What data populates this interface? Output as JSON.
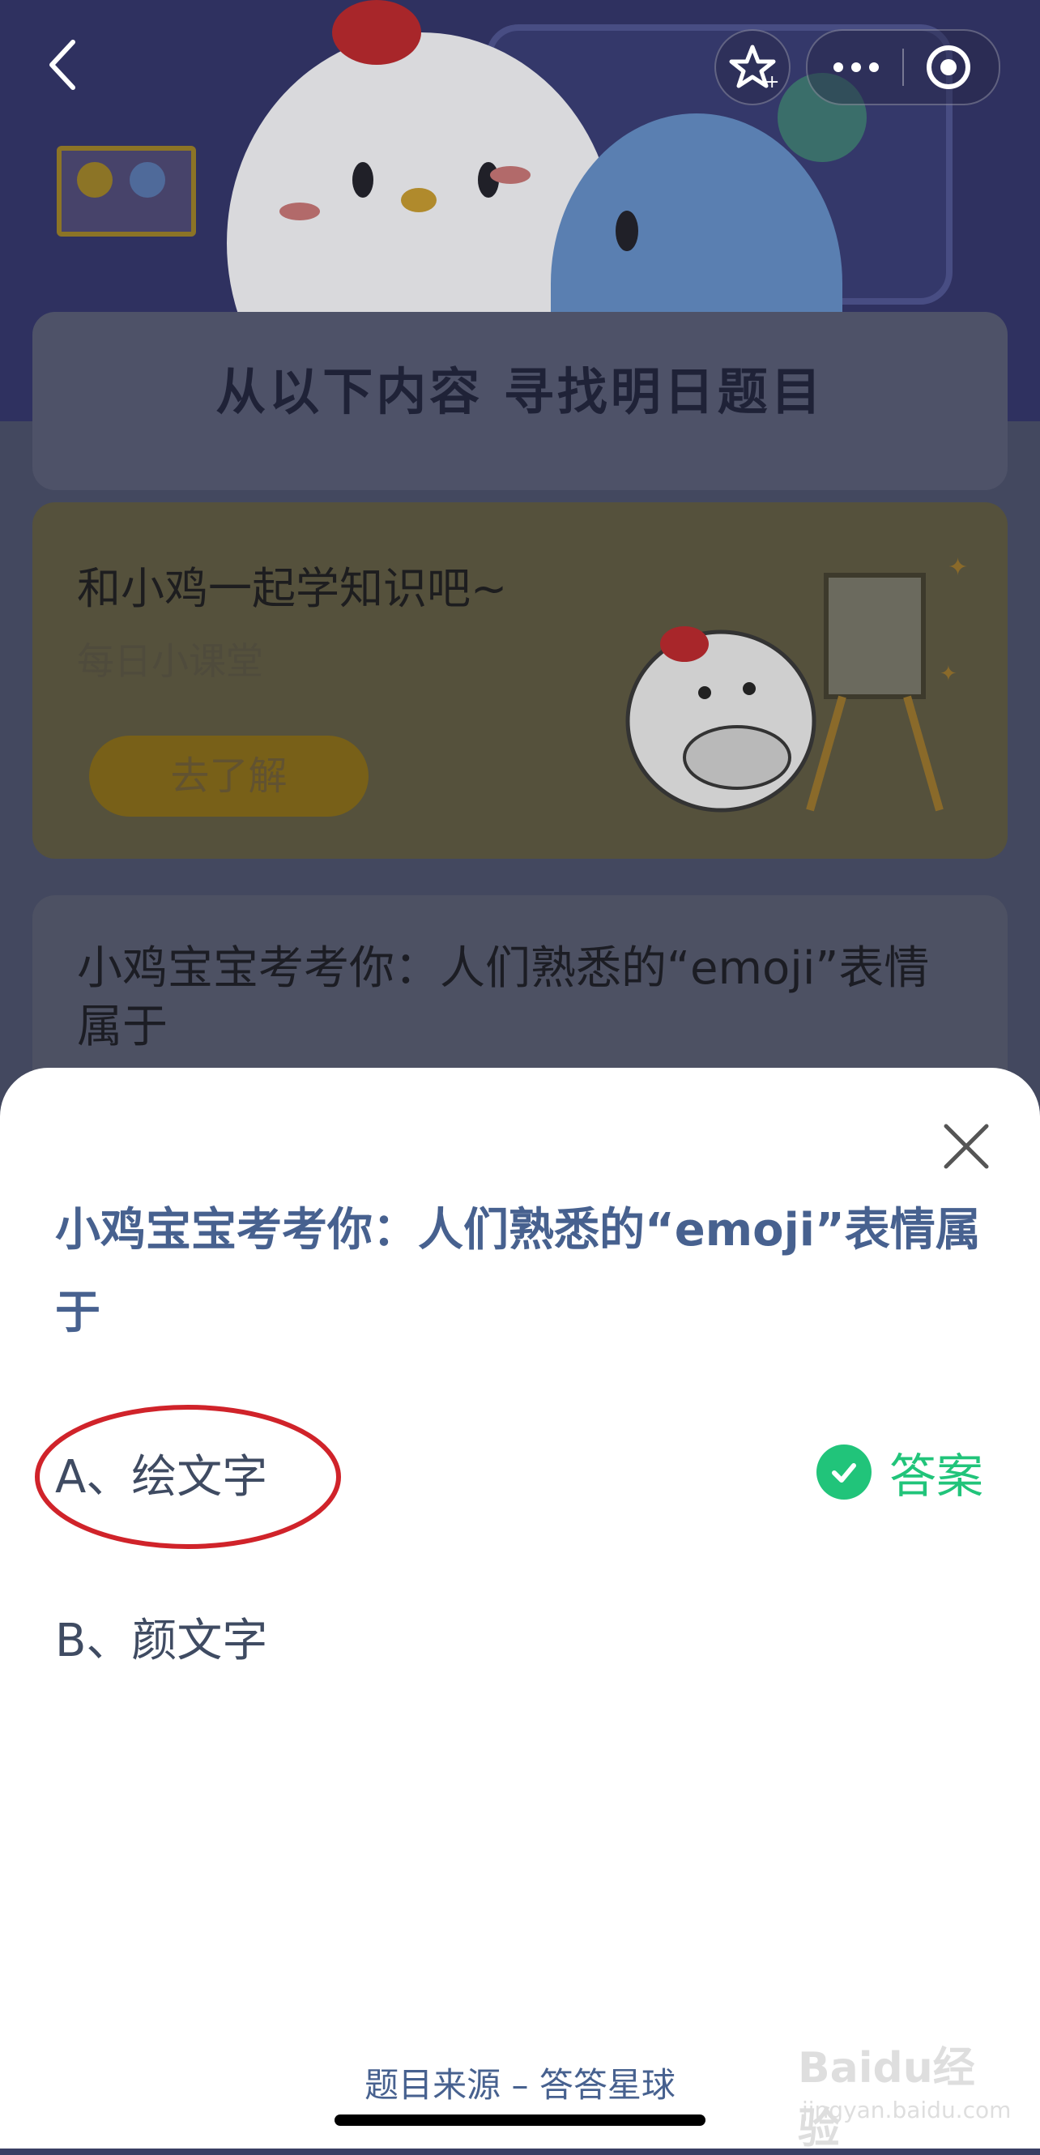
{
  "background": {
    "banner_title": "从以下内容  寻找明日题目",
    "learn_card": {
      "title": "和小鸡一起学知识吧~",
      "subtitle": "每日小课堂",
      "button": "去了解"
    },
    "quiz_card_question": "小鸡宝宝考考你：人们熟悉的“emoji”表情属于"
  },
  "nav": {
    "back_icon": "chevron-left-icon",
    "star_icon": "star-icon",
    "more_icon": "ellipsis-icon",
    "target_icon": "target-circle-icon"
  },
  "sheet": {
    "question": "小鸡宝宝考考你：人们熟悉的“emoji”表情属于",
    "options": [
      {
        "label": "A、绘文字",
        "correct": true
      },
      {
        "label": "B、颜文字",
        "correct": false
      }
    ],
    "answer_label": "答案",
    "source": "题目来源 – 答答星球"
  },
  "watermark": {
    "brand": "Baidu经验",
    "url": "jingyan.baidu.com"
  },
  "colors": {
    "question": "#47618f",
    "answer_green": "#21c47a",
    "annotation_red": "#d0232a"
  }
}
